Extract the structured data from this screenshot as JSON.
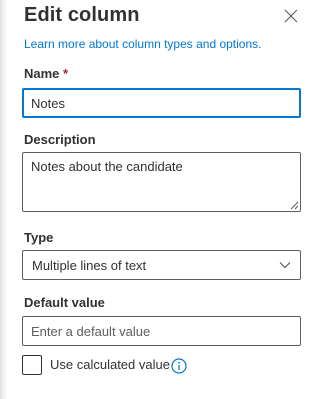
{
  "panel": {
    "title": "Edit column",
    "learn_more": "Learn more about column types and options."
  },
  "name_field": {
    "label": "Name",
    "required_marker": "*",
    "value": "Notes"
  },
  "description_field": {
    "label": "Description",
    "value": "Notes about the candidate"
  },
  "type_field": {
    "label": "Type",
    "selected": "Multiple lines of text",
    "icon": "chevron-down-icon"
  },
  "default_value_field": {
    "label": "Default value",
    "placeholder": "Enter a default value",
    "value": ""
  },
  "calculated": {
    "label": "Use calculated value",
    "checked": false,
    "icon": "info-icon"
  },
  "colors": {
    "accent": "#0078d4",
    "required": "#a4262c",
    "text": "#323130",
    "border": "#605e5c"
  }
}
